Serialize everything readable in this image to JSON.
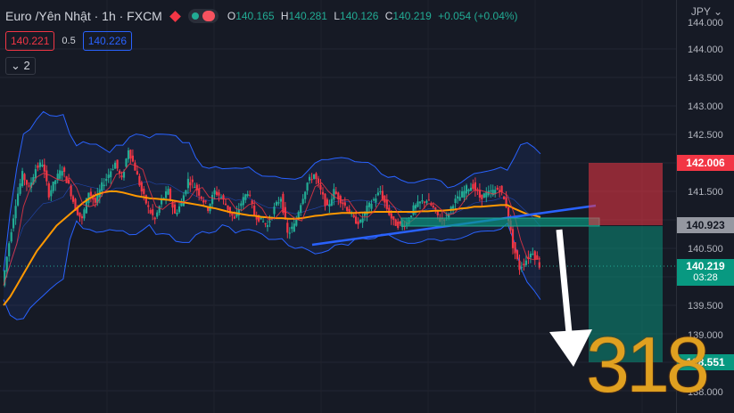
{
  "header": {
    "symbol": "Euro /Yên Nhật · 1h · FXCM",
    "ohlc": {
      "o_label": "O",
      "o": "140.165",
      "h_label": "H",
      "h": "140.281",
      "l_label": "L",
      "l": "140.126",
      "c_label": "C",
      "c": "140.219",
      "change": "+0.054 (+0.04%)"
    }
  },
  "trade": {
    "bid": "140.221",
    "spread": "0.5",
    "ask": "140.226"
  },
  "indicators_toggle": "⌄ 2",
  "axis": {
    "currency": "JPY ⌄",
    "ticks": [
      "144.000",
      "143.500",
      "143.000",
      "142.500",
      "142.000",
      "141.500",
      "141.000",
      "140.500",
      "140.000",
      "139.500",
      "139.000",
      "138.500",
      "138.000"
    ],
    "stop_label": "142.006",
    "entry_label": "140.923",
    "last_price": "140.219",
    "last_time": "03:28",
    "target_label": "138.551"
  },
  "overlay_logo": "318",
  "colors": {
    "bg": "#161a25",
    "up": "#22ab94",
    "down": "#f23645",
    "bb": "#2962ff",
    "ma": "#ff9800"
  },
  "chart_data": {
    "type": "line",
    "ylim": [
      137.95,
      144.1
    ],
    "series": [
      {
        "values": [
          139.85,
          140.6,
          141.3,
          141.8,
          141.55,
          141.9,
          142.0,
          141.45,
          141.7,
          141.9,
          141.6,
          141.2,
          141.0,
          141.5,
          141.3,
          141.6,
          141.8,
          142.0,
          141.7,
          142.25,
          141.9,
          141.5,
          141.2,
          141.0,
          141.35,
          141.5,
          141.1,
          141.3,
          141.7,
          141.6,
          141.4,
          141.2,
          141.5,
          141.4,
          141.2,
          141.0,
          141.3,
          141.5,
          141.1,
          141.0,
          140.9,
          141.2,
          141.4,
          140.75,
          140.9,
          141.3,
          141.65,
          141.8,
          141.5,
          141.2,
          141.5,
          141.35,
          141.2,
          141.0,
          140.95,
          141.2,
          141.35,
          141.5,
          141.2,
          140.95,
          140.9,
          140.95,
          141.2,
          141.3,
          141.35,
          141.2,
          141.0,
          141.05,
          141.3,
          141.4,
          141.55,
          141.6,
          141.4,
          141.45,
          141.5,
          141.55,
          141.25,
          140.55,
          140.15,
          140.3,
          140.45,
          140.2
        ]
      },
      {
        "values": [
          139.5,
          139.65,
          139.85,
          140.05,
          140.25,
          140.45,
          140.6,
          140.75,
          140.9,
          141.0,
          141.1,
          141.2,
          141.3,
          141.38,
          141.44,
          141.48,
          141.5,
          141.5,
          141.48,
          141.45,
          141.42,
          141.4,
          141.38,
          141.37,
          141.36,
          141.35,
          141.33,
          141.31,
          141.29,
          141.27,
          141.25,
          141.22,
          141.2,
          141.17,
          141.14,
          141.12,
          141.1,
          141.08,
          141.07,
          141.05,
          141.04,
          141.03,
          141.03,
          141.02,
          141.02,
          141.03,
          141.05,
          141.07,
          141.08,
          141.1,
          141.11,
          141.12,
          141.12,
          141.12,
          141.13,
          141.13,
          141.14,
          141.14,
          141.14,
          141.14,
          141.14,
          141.14,
          141.14,
          141.15,
          141.15,
          141.16,
          141.16,
          141.17,
          141.18,
          141.2,
          141.21,
          141.23,
          141.23,
          141.24,
          141.25,
          141.26,
          141.26,
          141.2,
          141.15,
          141.1,
          141.08,
          141.05
        ]
      }
    ]
  }
}
